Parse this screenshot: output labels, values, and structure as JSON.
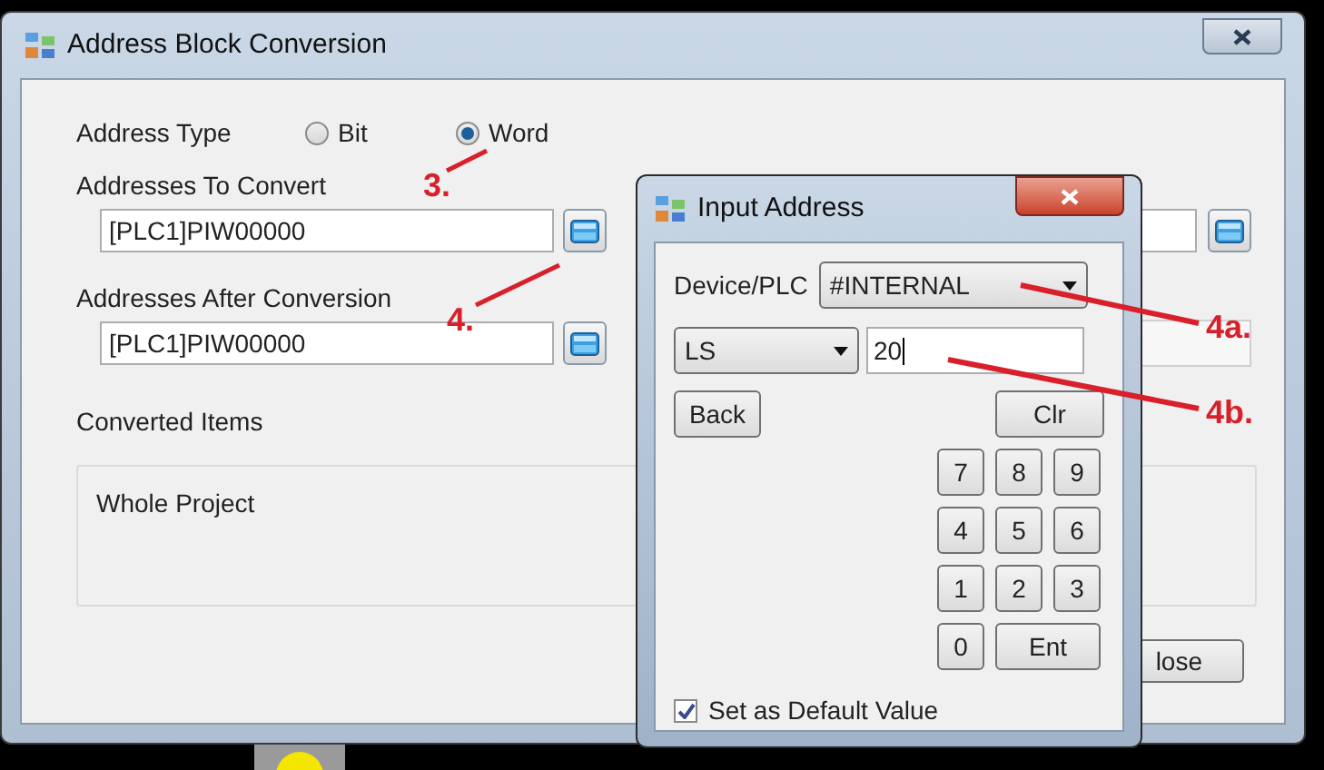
{
  "window": {
    "title": "Address Block Conversion"
  },
  "address_type": {
    "label": "Address Type",
    "options": [
      {
        "label": "Bit",
        "selected": false
      },
      {
        "label": "Word",
        "selected": true
      }
    ]
  },
  "addresses_to_convert": {
    "label": "Addresses To Convert",
    "value": "[PLC1]PIW00000"
  },
  "addresses_after_conversion": {
    "label": "Addresses After Conversion",
    "value": "[PLC1]PIW00000"
  },
  "converted_items": {
    "label": "Converted Items",
    "value": "Whole Project"
  },
  "close_button": "lose",
  "dialog": {
    "title": "Input Address",
    "device_label": "Device/PLC",
    "device": "#INTERNAL",
    "area": "LS",
    "address": "20",
    "back": "Back",
    "clear": "Clr",
    "keys": [
      [
        "7",
        "8",
        "9"
      ],
      [
        "4",
        "5",
        "6"
      ],
      [
        "1",
        "2",
        "3"
      ]
    ],
    "zero": "0",
    "enter": "Ent",
    "default_checkbox": {
      "label": "Set as Default Value",
      "checked": true
    }
  },
  "annotations": [
    {
      "label": "3."
    },
    {
      "label": "4."
    },
    {
      "label": "4a."
    },
    {
      "label": "4b."
    }
  ]
}
